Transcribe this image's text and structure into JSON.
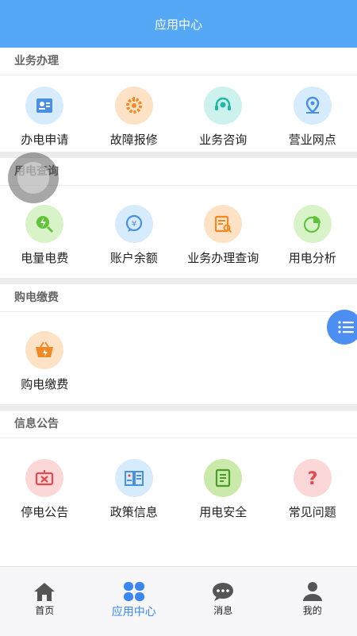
{
  "header": {
    "title": "应用中心"
  },
  "sections": [
    {
      "title": "业务办理",
      "items": [
        {
          "label": "办电申请",
          "icon": "id-card-icon"
        },
        {
          "label": "故障报修",
          "icon": "gear-wrench-icon"
        },
        {
          "label": "业务咨询",
          "icon": "headset-icon"
        },
        {
          "label": "营业网点",
          "icon": "location-pin-icon"
        }
      ]
    },
    {
      "title": "用电查询",
      "items": [
        {
          "label": "电量电费",
          "icon": "lightning-search-icon"
        },
        {
          "label": "账户余额",
          "icon": "yen-chat-icon"
        },
        {
          "label": "业务办理查询",
          "icon": "document-search-icon"
        },
        {
          "label": "用电分析",
          "icon": "pie-chart-icon"
        }
      ]
    },
    {
      "title": "购电缴费",
      "items": [
        {
          "label": "购电缴费",
          "icon": "basket-icon"
        }
      ]
    },
    {
      "title": "信息公告",
      "items": [
        {
          "label": "停电公告",
          "icon": "power-off-icon"
        },
        {
          "label": "政策信息",
          "icon": "book-icon"
        },
        {
          "label": "用电安全",
          "icon": "shield-document-icon"
        },
        {
          "label": "常见问题",
          "icon": "question-icon"
        }
      ]
    }
  ],
  "tabbar": [
    {
      "label": "首页",
      "icon": "home-icon"
    },
    {
      "label": "应用中心",
      "icon": "four-petal-icon",
      "active": true
    },
    {
      "label": "消息",
      "icon": "chat-bubble-icon"
    },
    {
      "label": "我的",
      "icon": "person-icon"
    }
  ],
  "colors": {
    "header": "#55a8f6",
    "accent": "#3b86f0",
    "icon_blue_bg": "#d6ebfb",
    "icon_orange_bg": "#fde2c6",
    "icon_teal_bg": "#cdf1ec",
    "icon_green_bg": "#d9f3c8",
    "icon_red_bg": "#fbd7d7"
  }
}
